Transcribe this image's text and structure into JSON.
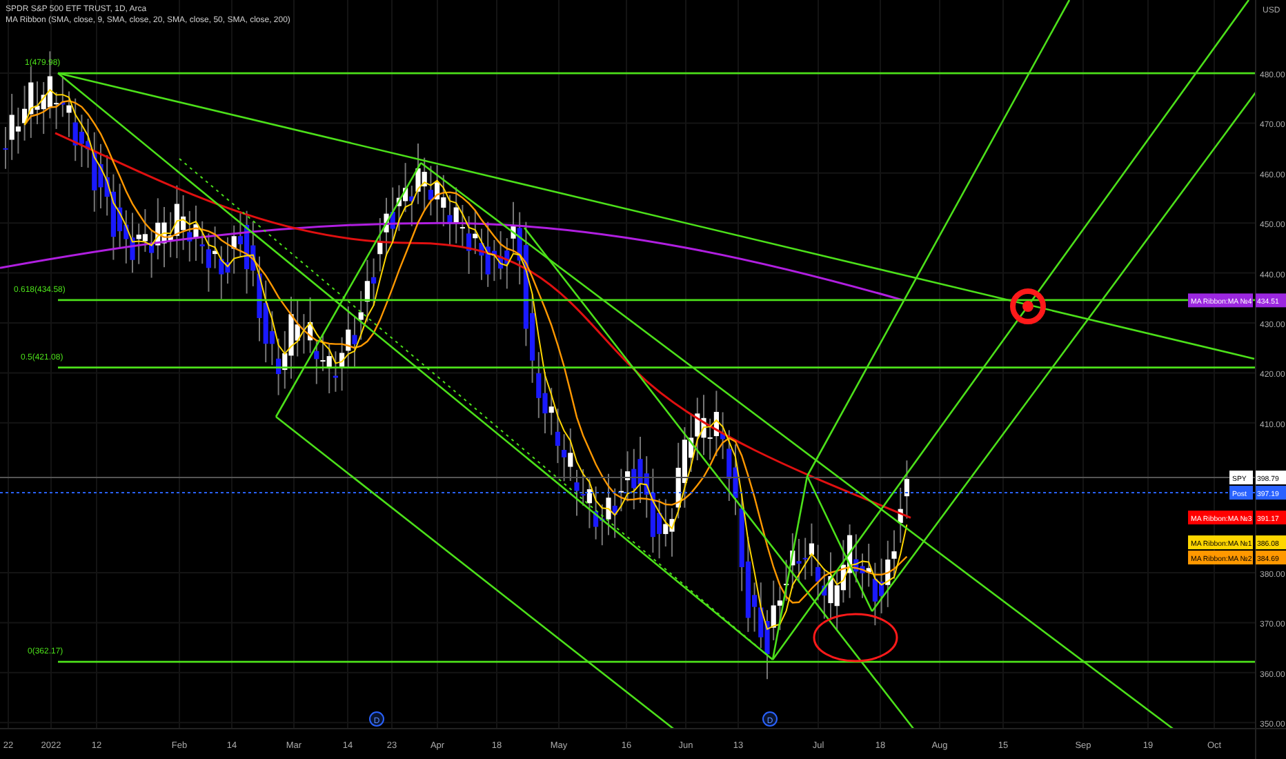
{
  "legend": {
    "symbol": "SPDR S&P 500 ETF TRUST, 1D, Arca",
    "indicator": "MA Ribbon (SMA, close, 9, SMA, close, 20, SMA, close, 50, SMA, close, 200)"
  },
  "price_axis": {
    "currency": "USD",
    "ticks": [
      "480.00",
      "470.00",
      "460.00",
      "450.00",
      "440.00",
      "430.00",
      "420.00",
      "410.00",
      "380.00",
      "370.00",
      "360.00",
      "350.00"
    ]
  },
  "time_axis": [
    "22",
    "2022",
    "12",
    "Feb",
    "14",
    "Mar",
    "14",
    "23",
    "Apr",
    "18",
    "May",
    "16",
    "Jun",
    "13",
    "Jul",
    "18",
    "Aug",
    "15",
    "Sep",
    "19",
    "Oct"
  ],
  "fib_levels": [
    {
      "label": "1(479.98)"
    },
    {
      "label": "0.618(434.58)"
    },
    {
      "label": "0.5(421.08)"
    },
    {
      "label": "0(362.17)"
    }
  ],
  "price_tags": [
    {
      "name": "MA Ribbon:MA №4",
      "value": "434.51",
      "color": "#9c27e0"
    },
    {
      "name": "SPY",
      "value": "398.79",
      "color": "#ffffff"
    },
    {
      "name": "Post",
      "value": "397.19",
      "color": "#2962ff"
    },
    {
      "name": "MA Ribbon:MA №3",
      "value": "391.17",
      "color": "#ff0000"
    },
    {
      "name": "MA Ribbon:MA №1",
      "value": "386.08",
      "color": "#ffd600"
    },
    {
      "name": "MA Ribbon:MA №2",
      "value": "384.69",
      "color": "#ff9800"
    }
  ],
  "events": [
    {
      "label": "D"
    },
    {
      "label": "D"
    }
  ]
}
